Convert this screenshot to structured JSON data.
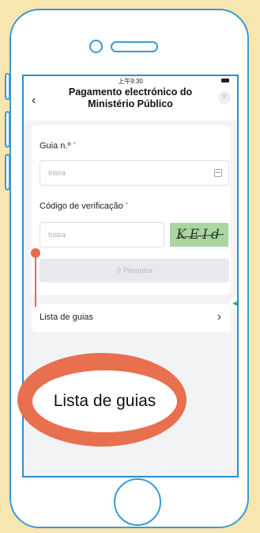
{
  "status_bar": {
    "time": "上午9:30"
  },
  "header": {
    "title": "Pagamento electrónico do Ministério Público"
  },
  "form": {
    "guia_label": "Guia n.º",
    "guia_placeholder": "Insira",
    "code_label": "Código de verificação",
    "code_placeholder": "Insira",
    "captcha_text": "KEId",
    "search_label": "Pesquisa",
    "required_mark": "*"
  },
  "list": {
    "label": "Lista de guias"
  },
  "callout": {
    "text": "Lista de guias"
  },
  "colors": {
    "phone_border": "#3a9ad3",
    "callout": "#e8704f",
    "background": "#f8e6b0",
    "captcha_bg": "#a9d6a1"
  }
}
